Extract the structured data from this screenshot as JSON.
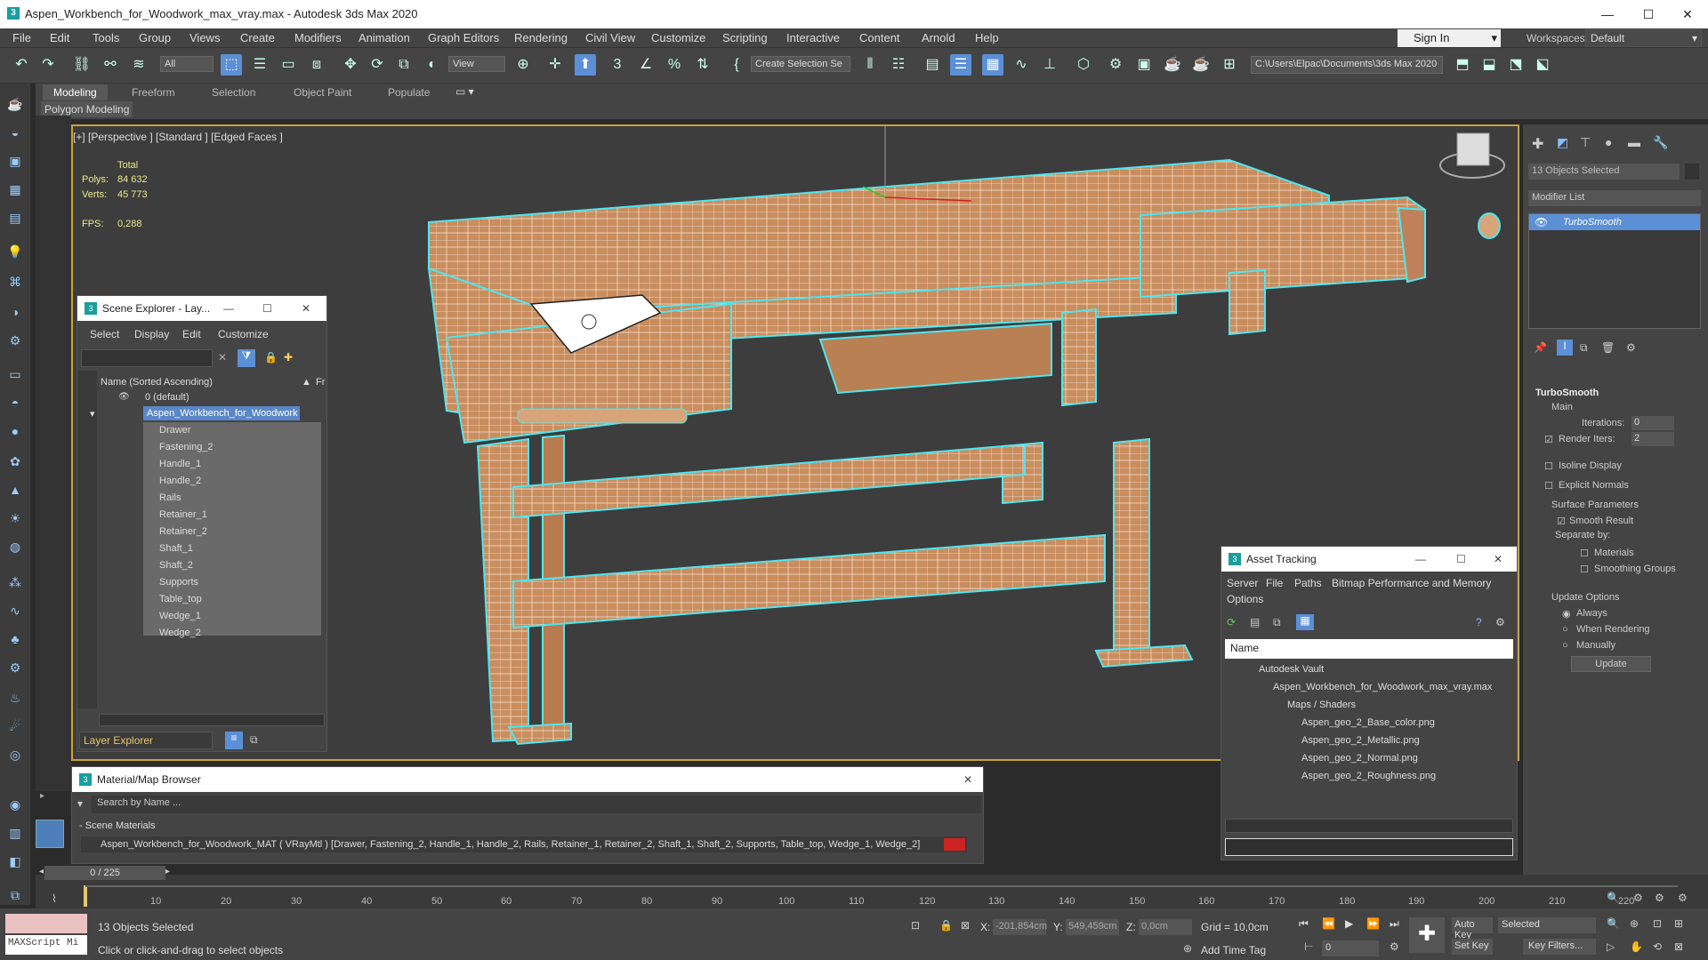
{
  "window": {
    "title": "Aspen_Workbench_for_Woodwork_max_vray.max - Autodesk 3ds Max 2020",
    "minimize": "—",
    "maximize": "☐",
    "close": "✕"
  },
  "menu": [
    "File",
    "Edit",
    "Tools",
    "Group",
    "Views",
    "Create",
    "Modifiers",
    "Animation",
    "Graph Editors",
    "Rendering",
    "Civil View",
    "Customize",
    "Scripting",
    "Interactive",
    "Content",
    "Arnold",
    "Help"
  ],
  "account": {
    "sign_in": "Sign In",
    "workspaces_label": "Workspaces:",
    "workspace": "Default"
  },
  "toolbar": {
    "filter": "All",
    "ref_coord": "View",
    "selection_set": "Create Selection Se",
    "project_path": "C:\\Users\\Elpac\\Documents\\3ds Max 2020"
  },
  "ribbon": {
    "tabs": [
      "Modeling",
      "Freeform",
      "Selection",
      "Object Paint",
      "Populate"
    ],
    "sub": "Polygon Modeling"
  },
  "viewport": {
    "label": "[+] [Perspective ] [Standard ] [Edged Faces ]",
    "total": "Total",
    "polys_label": "Polys:",
    "polys": "84 632",
    "verts_label": "Verts:",
    "verts": "45 773",
    "fps_label": "FPS:",
    "fps": "0,288"
  },
  "scene_explorer": {
    "title": "Scene Explorer - Lay...",
    "menu": [
      "Select",
      "Display",
      "Edit",
      "Customize"
    ],
    "column": "Name (Sorted Ascending)",
    "col2": "Fr",
    "default_layer": "0 (default)",
    "group": "Aspen_Workbench_for_Woodwork",
    "items": [
      "Drawer",
      "Fastening_2",
      "Handle_1",
      "Handle_2",
      "Rails",
      "Retainer_1",
      "Retainer_2",
      "Shaft_1",
      "Shaft_2",
      "Supports",
      "Table_top",
      "Wedge_1",
      "Wedge_2"
    ],
    "footer": "Layer Explorer"
  },
  "asset_tracking": {
    "title": "Asset Tracking",
    "menu": [
      "Server",
      "File",
      "Paths",
      "Bitmap Performance and Memory",
      "Options"
    ],
    "column": "Name",
    "rows": [
      "Autodesk Vault",
      "Aspen_Workbench_for_Woodwork_max_vray.max",
      "Maps / Shaders",
      "Aspen_geo_2_Base_color.png",
      "Aspen_geo_2_Metallic.png",
      "Aspen_geo_2_Normal.png",
      "Aspen_geo_2_Roughness.png"
    ]
  },
  "material_browser": {
    "title": "Material/Map Browser",
    "search": "Search by Name ...",
    "section": "- Scene Materials",
    "material": "Aspen_Workbench_for_Woodwork_MAT  ( VRayMtl )  [Drawer, Fastening_2, Handle_1, Handle_2, Rails, Retainer_1, Retainer_2, Shaft_1, Shaft_2, Supports, Table_top, Wedge_1, Wedge_2]"
  },
  "command_panel": {
    "selected": "13 Objects Selected",
    "modifier_list": "Modifier List",
    "modifier": "TurboSmooth",
    "rollout": "TurboSmooth",
    "main": "Main",
    "iterations_label": "Iterations:",
    "iterations": "0",
    "render_iters_label": "Render Iters:",
    "render_iters": "2",
    "isoline": "Isoline Display",
    "explicit": "Explicit Normals",
    "surface": "Surface Parameters",
    "smooth_result": "Smooth Result",
    "separate": "Separate by:",
    "materials": "Materials",
    "smoothing_groups": "Smoothing Groups",
    "update_options": "Update Options",
    "always": "Always",
    "when_rendering": "When Rendering",
    "manually": "Manually",
    "update": "Update"
  },
  "timeline": {
    "frame": "0 / 225",
    "ticks": [
      "10",
      "20",
      "30",
      "40",
      "50",
      "60",
      "70",
      "80",
      "90",
      "100",
      "110",
      "120",
      "130",
      "140",
      "150",
      "160",
      "170",
      "180",
      "190",
      "200",
      "210",
      "220"
    ]
  },
  "status": {
    "maxscript": "MAXScript Mi",
    "selected": "13 Objects Selected",
    "prompt": "Click or click-and-drag to select objects",
    "x_label": "X:",
    "x": "-201,854cm",
    "y_label": "Y:",
    "y": "549,459cm",
    "z_label": "Z:",
    "z": "0,0cm",
    "grid": "Grid = 10,0cm",
    "add_time_tag": "Add Time Tag",
    "auto_key": "Auto Key",
    "set_key": "Set Key",
    "key_mode": "Selected",
    "key_filters": "Key Filters...",
    "frame_field": "0"
  }
}
